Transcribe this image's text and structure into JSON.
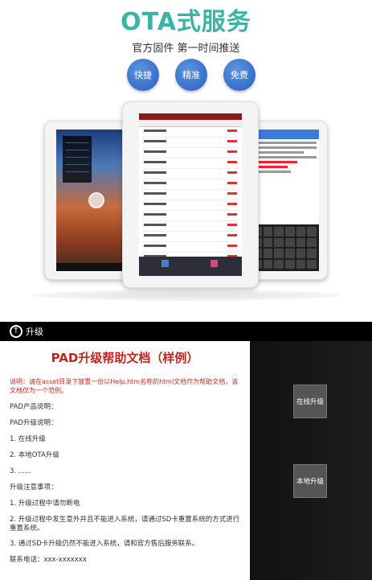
{
  "promo": {
    "title": "OTA式服务",
    "subtitle": "官方固件 第一时间推送",
    "pills": [
      "快捷",
      "精准",
      "免费"
    ]
  },
  "app": {
    "bar_title": "升级",
    "doc": {
      "heading": "PAD升级帮助文档（样例）",
      "note": "说明：请在asset目录下放置一份以Help.htm名称的html文档作为帮助文档，该文档仅为一个范例。",
      "lines": [
        "PAD产品说明：",
        "PAD升级说明：",
        "1. 在线升级",
        "2. 本地OTA升级",
        "3. ......",
        "升级注意事项：",
        "1. 升级过程中请勿断电",
        "2. 升级过程中发生意外并且不能进入系统，请通过SD卡重置系统的方式进行重置系统。",
        "3. 通过SD卡升级仍然不能进入系统，请和官方售后服务联系。",
        "联系电话：xxx-xxxxxxx"
      ]
    },
    "buttons": {
      "online": "在线升级",
      "local": "本地升级"
    }
  },
  "icons": {
    "up": "up-arrow-icon"
  }
}
